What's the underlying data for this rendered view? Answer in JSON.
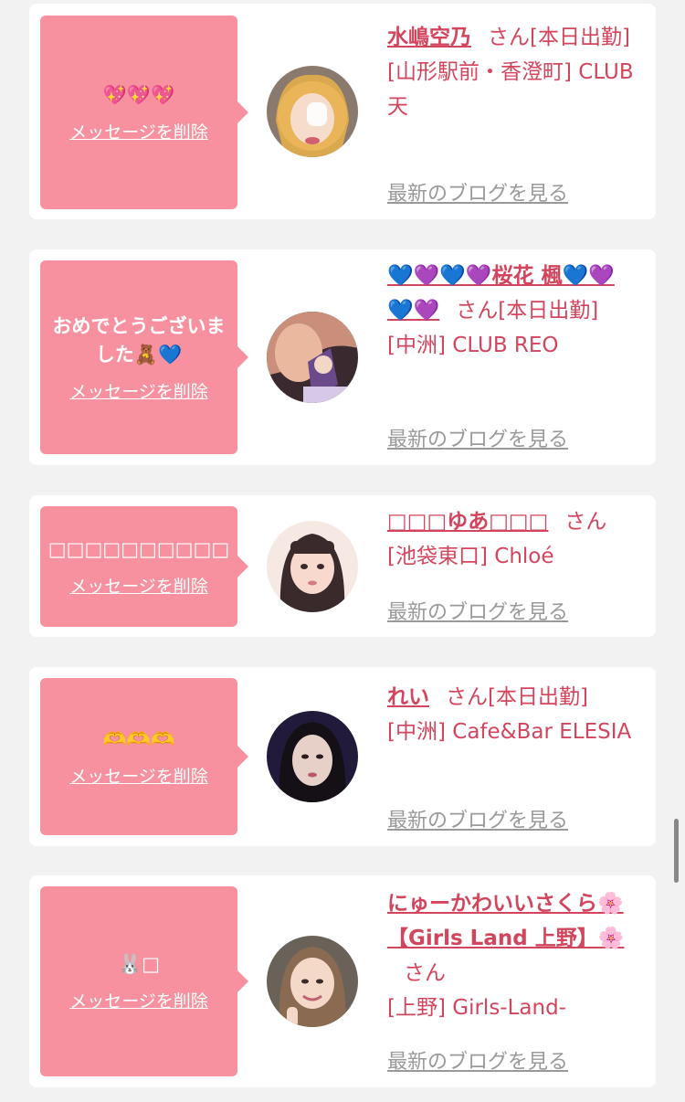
{
  "delete_label": "メッセージを削除",
  "blog_label": "最新のブログを見る",
  "accent_color": "#f7919f",
  "name_color": "#d2455d",
  "cards": [
    {
      "message": "💖💖💖",
      "name": "水嶋空乃",
      "san": "さん",
      "status": "[本日出勤]",
      "location": "[山形駅前・香澄町] CLUB 天",
      "avatar": "avatar-photo"
    },
    {
      "message": "おめでとうございました🧸💙",
      "name": "💙💜💙💜桜花 楓💙💜💙💜",
      "san": "さん",
      "status": "[本日出勤]",
      "location": "[中洲] CLUB REO",
      "avatar": "avatar-photo"
    },
    {
      "message": "□□□□□□□□□□",
      "name": "□□□ゆあ□□□",
      "san": "さん",
      "status": "",
      "location": "[池袋東口] Chloé",
      "avatar": "avatar-photo"
    },
    {
      "message": "🫶🫶🫶",
      "name": "れい",
      "san": "さん",
      "status": "[本日出勤]",
      "location": "[中洲] Cafe&Bar ELESIA",
      "avatar": "avatar-photo"
    },
    {
      "message": "🐰□",
      "name": "にゅーかわいいさくら🌸【Girls Land 上野】🌸",
      "san": "さん",
      "status": "",
      "location": "[上野] Girls-Land-",
      "avatar": "avatar-photo"
    }
  ]
}
